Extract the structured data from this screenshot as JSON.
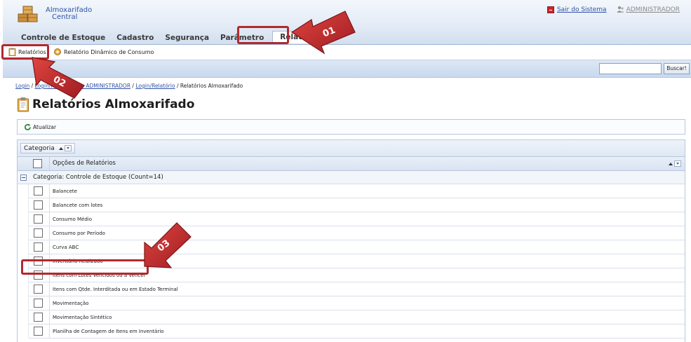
{
  "header": {
    "app_name_line1": "Almoxarifado",
    "app_name_line2": "Central",
    "exit_label": "Sair do Sistema",
    "user_label": "ADMINISTRADOR"
  },
  "menu": {
    "items": [
      {
        "label": "Controle de Estoque"
      },
      {
        "label": "Cadastro"
      },
      {
        "label": "Segurança"
      },
      {
        "label": "Parâmetro"
      },
      {
        "label": "Relatórios"
      }
    ]
  },
  "submenu": {
    "items": [
      {
        "label": "Relatórios"
      },
      {
        "label": "Relatório Dinâmico de Consumo"
      }
    ]
  },
  "search": {
    "value": "",
    "button_label": "Buscar!"
  },
  "breadcrumb": {
    "part1": "Login",
    "part2": "Login/Re",
    "part3": "ogin ADMINISTRADOR",
    "part4": "Login/Relatório",
    "current": "Relatórios Almoxarifado",
    "sep": " / "
  },
  "page": {
    "title": "Relatórios Almoxarifado"
  },
  "toolbar": {
    "refresh_label": "Atualizar"
  },
  "grid": {
    "group_by_label": "Categoria",
    "column_header": "Opções de Relatórios",
    "group_row_label": "Categoria: Controle de Estoque (Count=14)",
    "rows": [
      {
        "label": "Balancete"
      },
      {
        "label": "Balancete com lotes"
      },
      {
        "label": "Consumo Médio"
      },
      {
        "label": "Consumo por Período"
      },
      {
        "label": "Curva ABC"
      },
      {
        "label": "Inventário Realizado"
      },
      {
        "label": "Itens com Lotes Vencidos ou a Vencer"
      },
      {
        "label": "Itens com Qtde. Interditada ou em Estado Terminal"
      },
      {
        "label": "Movimentação"
      },
      {
        "label": "Movimentação Sintético"
      },
      {
        "label": "Planilha de Contagem de Itens em Inventário"
      }
    ]
  },
  "annotations": {
    "a1": "01",
    "a2": "02",
    "a3": "03",
    "color": "#c0272d"
  }
}
